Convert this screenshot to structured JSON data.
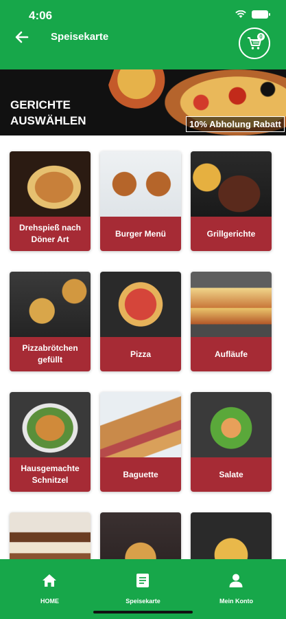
{
  "status_bar": {
    "time": "4:06"
  },
  "header": {
    "title": "Speisekarte",
    "cart_count": "0"
  },
  "banner": {
    "heading_line1": "GERICHTE",
    "heading_line2": "AUSWÄHLEN",
    "badge": "10% Abholung Rabatt"
  },
  "categories": [
    {
      "label": "Drehspieß nach Döner Art"
    },
    {
      "label": "Burger Menü"
    },
    {
      "label": "Grillgerichte"
    },
    {
      "label": "Pizzabrötchen gefüllt"
    },
    {
      "label": "Pizza"
    },
    {
      "label": "Aufläufe"
    },
    {
      "label": "Hausgemachte Schnitzel"
    },
    {
      "label": "Baguette"
    },
    {
      "label": "Salate"
    },
    {
      "label": ""
    },
    {
      "label": ""
    },
    {
      "label": ""
    }
  ],
  "tabbar": {
    "tabs": [
      {
        "label": "HOME",
        "icon": "home-icon"
      },
      {
        "label": "Speisekarte",
        "icon": "menu-icon"
      },
      {
        "label": "Mein Konto",
        "icon": "user-icon"
      }
    ]
  },
  "colors": {
    "primary_green": "#17a74a",
    "tile_red": "#a62b35"
  }
}
